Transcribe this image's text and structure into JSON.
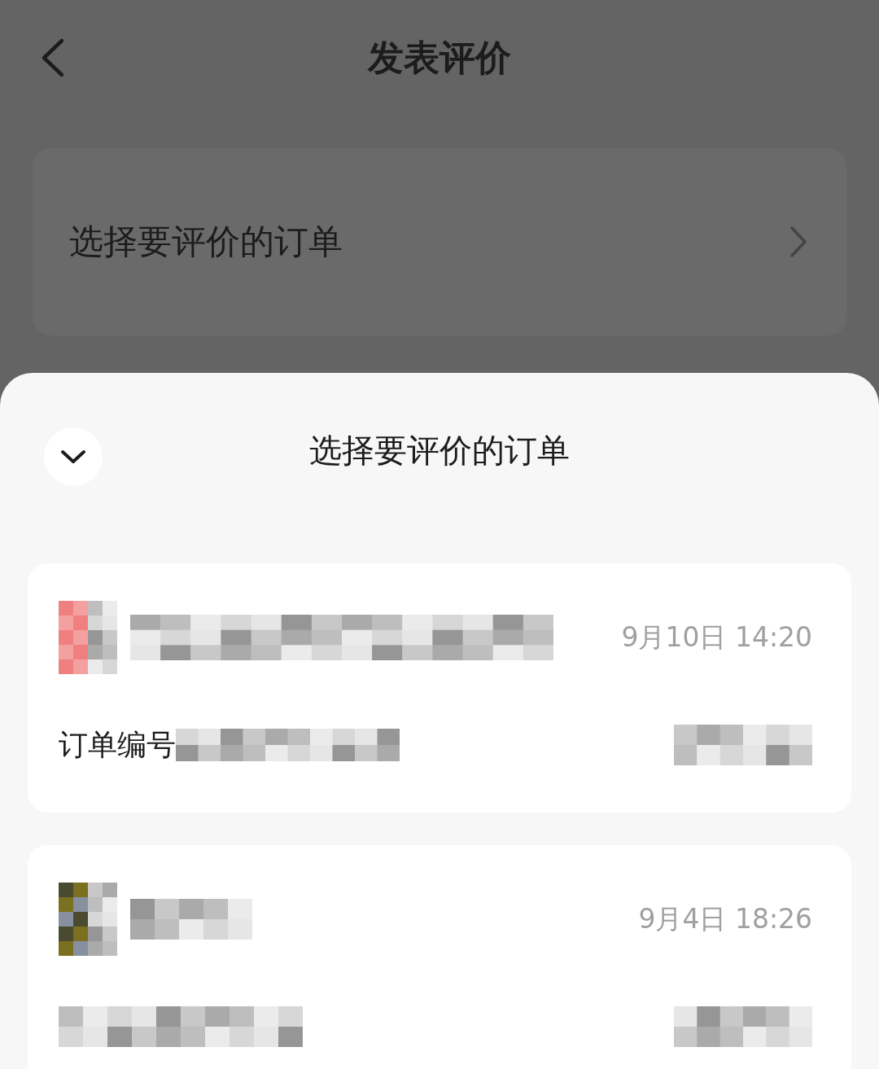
{
  "header": {
    "title": "发表评价"
  },
  "select_row": {
    "label": "选择要评价的订单"
  },
  "sheet": {
    "title": "选择要评价的订单",
    "orders": [
      {
        "date": "9月10日 14:20",
        "order_label": "订单编号"
      },
      {
        "date": "9月4日 18:26"
      }
    ]
  }
}
